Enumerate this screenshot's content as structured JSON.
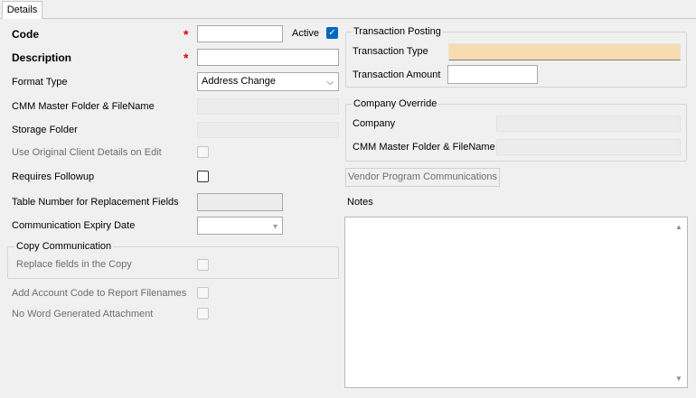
{
  "tabs": [
    {
      "label": "Details"
    }
  ],
  "left": {
    "code_label": "Code",
    "code_value": "",
    "required_mark": "*",
    "active_label": "Active",
    "active_checked": true,
    "description_label": "Description",
    "description_value": "",
    "format_type_label": "Format Type",
    "format_type_value": "Address Change",
    "cmm_folder_label": "CMM Master Folder & FileName",
    "storage_folder_label": "Storage Folder",
    "use_original_label": "Use Original Client Details on Edit",
    "requires_followup_label": "Requires Followup",
    "table_number_label": "Table Number for Replacement Fields",
    "expiry_date_label": "Communication Expiry Date",
    "copy_group_title": "Copy Communication",
    "replace_fields_label": "Replace fields in the Copy",
    "add_account_label": "Add Account Code to Report Filenames",
    "no_word_label": "No Word Generated Attachment"
  },
  "right": {
    "transaction_group_title": "Transaction Posting",
    "transaction_type_label": "Transaction Type",
    "transaction_type_value": "",
    "transaction_amount_label": "Transaction Amount",
    "transaction_amount_value": "",
    "company_group_title": "Company Override",
    "company_label": "Company",
    "company_cmm_label": "CMM Master Folder & FileName",
    "vendor_button_label": "Vendor Program Communications",
    "notes_label": "Notes",
    "notes_value": ""
  },
  "icons": {
    "check": "✓",
    "chevron": "⌵",
    "scroll_up": "▲",
    "scroll_down": "▼",
    "date_arrow": "▾"
  },
  "colors": {
    "required": "#e00000",
    "checkbox_checked": "#0067c0",
    "transaction_type_bg": "#f6dcb0"
  }
}
